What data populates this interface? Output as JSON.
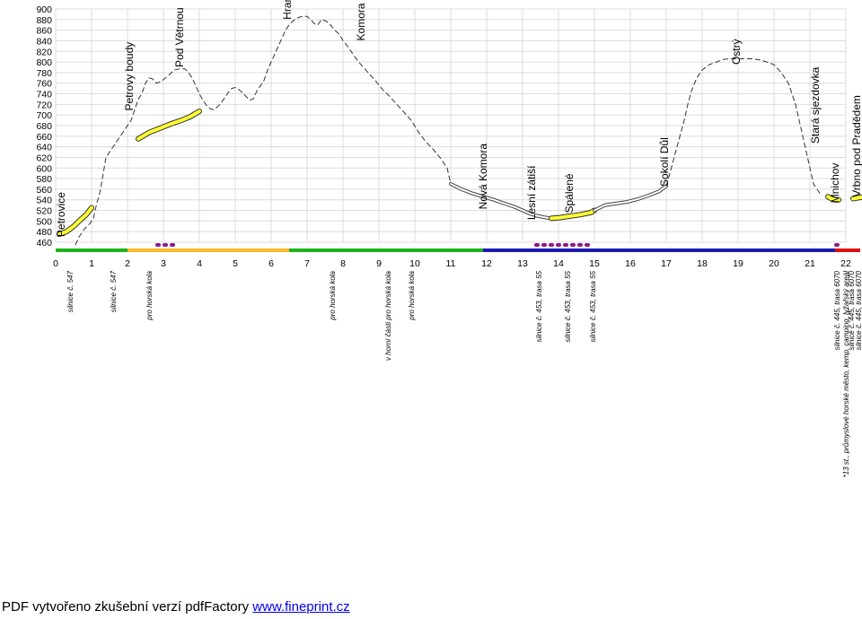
{
  "chart_data": {
    "type": "line",
    "xlim": [
      0,
      22
    ],
    "ylim": [
      460,
      900
    ],
    "x_ticks": [
      "0",
      "1",
      "2",
      "3",
      "4",
      "5",
      "6",
      "7",
      "8",
      "9",
      "10",
      "11",
      "12",
      "13",
      "14",
      "15",
      "16",
      "17",
      "18",
      "19",
      "20",
      "21",
      "22"
    ],
    "y_ticks": [
      "900",
      "880",
      "860",
      "840",
      "820",
      "800",
      "780",
      "760",
      "740",
      "720",
      "700",
      "680",
      "660",
      "640",
      "620",
      "600",
      "580",
      "560",
      "540",
      "520",
      "500",
      "480",
      "460"
    ],
    "grid": true,
    "series": [
      {
        "style": "dashed",
        "color": "#333333",
        "x": [
          0.55,
          0.65,
          0.8,
          0.95,
          1.05,
          1.1,
          1.15,
          1.2,
          1.25,
          1.3,
          1.4,
          1.6,
          1.8,
          2.0,
          2.1,
          2.2,
          2.3,
          2.4,
          2.5,
          2.6,
          2.7,
          2.8,
          2.9,
          3.0,
          3.15,
          3.3,
          3.45,
          3.6,
          3.7,
          3.8,
          3.9,
          4.0,
          4.1,
          4.2,
          4.3,
          4.4,
          4.5,
          4.6,
          4.7,
          4.8,
          4.9,
          5.0,
          5.1,
          5.2,
          5.3,
          5.4,
          5.5,
          5.6,
          5.7,
          5.8,
          5.9,
          6.0,
          6.1,
          6.2,
          6.3,
          6.4,
          6.5,
          6.6,
          6.7,
          6.8,
          6.9,
          7.0,
          7.1,
          7.2,
          7.3,
          7.4,
          7.5,
          7.6,
          7.7,
          7.8,
          7.9,
          8.0,
          8.15,
          8.3,
          8.5,
          8.7,
          8.9,
          9.1,
          9.3,
          9.5,
          9.7,
          9.9,
          10.1,
          10.3,
          10.5,
          10.7,
          10.9,
          11.0
        ],
        "y": [
          455,
          470,
          485,
          495,
          505,
          520,
          535,
          545,
          560,
          580,
          620,
          640,
          660,
          680,
          690,
          710,
          730,
          740,
          760,
          770,
          768,
          760,
          762,
          767,
          775,
          785,
          787,
          787,
          780,
          770,
          755,
          740,
          728,
          718,
          712,
          710,
          715,
          722,
          732,
          742,
          750,
          752,
          748,
          742,
          735,
          728,
          730,
          745,
          755,
          765,
          785,
          800,
          815,
          830,
          845,
          860,
          870,
          877,
          882,
          885,
          886,
          886,
          880,
          872,
          870,
          880,
          878,
          874,
          866,
          858,
          852,
          840,
          828,
          812,
          795,
          780,
          765,
          748,
          735,
          720,
          705,
          690,
          668,
          650,
          636,
          620,
          600,
          570
        ]
      },
      {
        "style": "double",
        "color": "#444444",
        "x": [
          11.0,
          11.3,
          11.6,
          11.9,
          12.2,
          12.5,
          12.8,
          13.0,
          13.2,
          13.4,
          13.6,
          13.8
        ],
        "y": [
          570,
          560,
          552,
          546,
          540,
          533,
          526,
          520,
          514,
          510,
          507,
          505
        ]
      },
      {
        "style": "highlight",
        "color": "#ffff33",
        "x": [
          13.8,
          14.0,
          14.3,
          14.6,
          14.9,
          15.0
        ],
        "y": [
          505,
          506,
          509,
          512,
          516,
          520
        ]
      },
      {
        "style": "double",
        "color": "#444444",
        "x": [
          15.0,
          15.3,
          15.6,
          15.9,
          16.2,
          16.5,
          16.8,
          17.0
        ],
        "y": [
          520,
          530,
          533,
          536,
          541,
          548,
          556,
          566
        ]
      },
      {
        "style": "dashed",
        "color": "#333333",
        "x": [
          17.0,
          17.1,
          17.2,
          17.3,
          17.4,
          17.5,
          17.6,
          17.7,
          17.85,
          18.0,
          18.2,
          18.4,
          18.6,
          18.8,
          19.0,
          19.2,
          19.4,
          19.6,
          19.8,
          20.0,
          20.2,
          20.4,
          20.5,
          20.6,
          20.7,
          20.8,
          20.9,
          21.0,
          21.1,
          21.2,
          21.3
        ],
        "y": [
          566,
          590,
          615,
          640,
          665,
          690,
          720,
          745,
          770,
          785,
          795,
          800,
          805,
          806,
          806,
          806,
          806,
          804,
          800,
          795,
          780,
          760,
          740,
          720,
          690,
          660,
          630,
          600,
          570,
          560,
          550
        ]
      }
    ],
    "highlights": [
      {
        "x": [
          0.1,
          0.3,
          0.5,
          0.7,
          0.85,
          1.0
        ],
        "y": [
          475,
          480,
          490,
          503,
          512,
          525
        ]
      },
      {
        "x": [
          2.3,
          2.6,
          2.9,
          3.2,
          3.5,
          3.75,
          4.0
        ],
        "y": [
          655,
          667,
          675,
          683,
          690,
          697,
          707
        ]
      },
      {
        "x": [
          21.5,
          21.6,
          21.7,
          21.8
        ],
        "y": [
          546,
          542,
          540,
          540
        ]
      },
      {
        "x": [
          22.2,
          22.35,
          22.55
        ],
        "y": [
          542,
          544,
          546
        ]
      }
    ],
    "surface_bar": [
      {
        "from": 0,
        "to": 2,
        "color": "#1db31d"
      },
      {
        "from": 2,
        "to": 6.5,
        "color": "#ffb829"
      },
      {
        "from": 6.5,
        "to": 11.9,
        "color": "#1db31d"
      },
      {
        "from": 11.9,
        "to": 21.7,
        "color": "#1a1ab3"
      },
      {
        "from": 21.7,
        "to": 22.4,
        "color": "#e01010"
      }
    ],
    "markers": [
      {
        "x": 2.85,
        "color": "#8a1a8a"
      },
      {
        "x": 3.05,
        "color": "#8a1a8a"
      },
      {
        "x": 3.25,
        "color": "#8a1a8a"
      },
      {
        "x": 13.4,
        "color": "#8a1a8a"
      },
      {
        "x": 13.6,
        "color": "#8a1a8a"
      },
      {
        "x": 13.8,
        "color": "#8a1a8a"
      },
      {
        "x": 14.0,
        "color": "#8a1a8a"
      },
      {
        "x": 14.2,
        "color": "#8a1a8a"
      },
      {
        "x": 14.4,
        "color": "#8a1a8a"
      },
      {
        "x": 14.6,
        "color": "#8a1a8a"
      },
      {
        "x": 14.8,
        "color": "#8a1a8a"
      },
      {
        "x": 21.75,
        "color": "#8a1a8a"
      }
    ],
    "places": [
      {
        "x": 0.15,
        "y": 470,
        "text": "Petrovice"
      },
      {
        "x": 2.05,
        "y": 708,
        "text": "Petrovy boudy"
      },
      {
        "x": 3.45,
        "y": 790,
        "text": "Pod Větrnou"
      },
      {
        "x": 6.45,
        "y": 880,
        "text": "Hraniční cesta"
      },
      {
        "x": 8.5,
        "y": 840,
        "text": "Komora"
      },
      {
        "x": 11.9,
        "y": 522,
        "text": "Nová Komora"
      },
      {
        "x": 13.25,
        "y": 502,
        "text": "Lesní zátiší"
      },
      {
        "x": 14.3,
        "y": 515,
        "text": "Spálené"
      },
      {
        "x": 16.95,
        "y": 565,
        "text": "Sokolí Důl"
      },
      {
        "x": 18.95,
        "y": 795,
        "text": "Ostrý"
      },
      {
        "x": 21.15,
        "y": 646,
        "text": "Stará sjezdovka"
      },
      {
        "x": 21.7,
        "y": 534,
        "text": "Mnichov"
      },
      {
        "x": 22.3,
        "y": 545,
        "text": "Vrbno pod Pradědem"
      }
    ],
    "notes": [
      {
        "x": 0.4,
        "text": "silnice č. 547"
      },
      {
        "x": 1.6,
        "text": "silnice č. 547"
      },
      {
        "x": 2.6,
        "text": "pro horská kola"
      },
      {
        "x": 7.7,
        "text": "pro horská kola"
      },
      {
        "x": 9.25,
        "text": "v horní části pro horská kola"
      },
      {
        "x": 9.9,
        "text": "pro horská kola"
      },
      {
        "x": 13.45,
        "text": "silnice č. 453, trasa 55"
      },
      {
        "x": 14.25,
        "text": "silnice č. 453, trasa 55"
      },
      {
        "x": 14.95,
        "text": "silnice č. 453, trasa 55"
      },
      {
        "x": 21.75,
        "text": "silnice č. 445, trasa 6070"
      },
      {
        "x": 22.0,
        "text": "*13 st., průmyslové horské město, kemp, camping, lyžařský areál"
      },
      {
        "x": 22.15,
        "text": "silnice č. 445, trasa 6070"
      },
      {
        "x": 22.35,
        "text": "silnice č. 445, trasa 6070"
      }
    ]
  },
  "footer": {
    "text": "PDF vytvořeno zkušební verzí pdfFactory ",
    "link": "www.fineprint.cz"
  }
}
